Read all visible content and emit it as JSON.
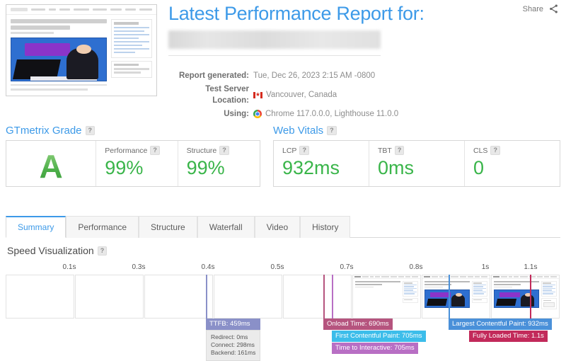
{
  "header": {
    "title": "Latest Performance Report for:",
    "share_label": "Share",
    "share_icon": "share-icon"
  },
  "meta": {
    "generated_label": "Report generated:",
    "generated_value": "Tue, Dec 26, 2023 2:15 AM -0800",
    "location_label": "Test Server Location:",
    "location_value": "Vancouver, Canada",
    "location_flag": "canada-flag-icon",
    "using_label": "Using:",
    "using_value": "Chrome 117.0.0.0, Lighthouse 11.0.0",
    "using_icon": "chrome-icon"
  },
  "gtmetrix_grade": {
    "section_title": "GTmetrix Grade",
    "help": "?",
    "grade": "A",
    "metrics": [
      {
        "label": "Performance",
        "value": "99%",
        "help": "?"
      },
      {
        "label": "Structure",
        "value": "99%",
        "help": "?"
      }
    ]
  },
  "web_vitals": {
    "section_title": "Web Vitals",
    "help": "?",
    "metrics": [
      {
        "label": "LCP",
        "value": "932ms",
        "help": "?"
      },
      {
        "label": "TBT",
        "value": "0ms",
        "help": "?"
      },
      {
        "label": "CLS",
        "value": "0",
        "help": "?"
      }
    ]
  },
  "tabs": [
    {
      "label": "Summary",
      "active": true
    },
    {
      "label": "Performance",
      "active": false
    },
    {
      "label": "Structure",
      "active": false
    },
    {
      "label": "Waterfall",
      "active": false
    },
    {
      "label": "Video",
      "active": false
    },
    {
      "label": "History",
      "active": false
    }
  ],
  "speed_visualization": {
    "title": "Speed Visualization",
    "help": "?",
    "tick_labels": [
      "0.1s",
      "0.3s",
      "0.4s",
      "0.5s",
      "0.7s",
      "0.8s",
      "1s",
      "1.1s"
    ],
    "ttfb": {
      "label": "TTFB: 459ms",
      "redirect": "Redirect: 0ms",
      "connect": "Connect: 298ms",
      "backend": "Backend: 161ms",
      "color": "#8a90c8"
    },
    "events": [
      {
        "name": "onload-time",
        "label": "Onload Time: 690ms",
        "color": "#b5547e"
      },
      {
        "name": "first-contentful-paint",
        "label": "First Contentful Paint: 705ms",
        "color": "#3cbdea"
      },
      {
        "name": "time-to-interactive",
        "label": "Time to Interactive: 705ms",
        "color": "#b86fc4"
      },
      {
        "name": "largest-contentful-paint",
        "label": "Largest Contentful Paint: 932ms",
        "color": "#4a90d9"
      },
      {
        "name": "fully-loaded-time",
        "label": "Fully Loaded Time: 1.1s",
        "color": "#c22a5a"
      }
    ]
  },
  "colors": {
    "brand_blue": "#3d9ae8",
    "score_green": "#3ab54a",
    "panel_border": "#d8d8d8"
  }
}
